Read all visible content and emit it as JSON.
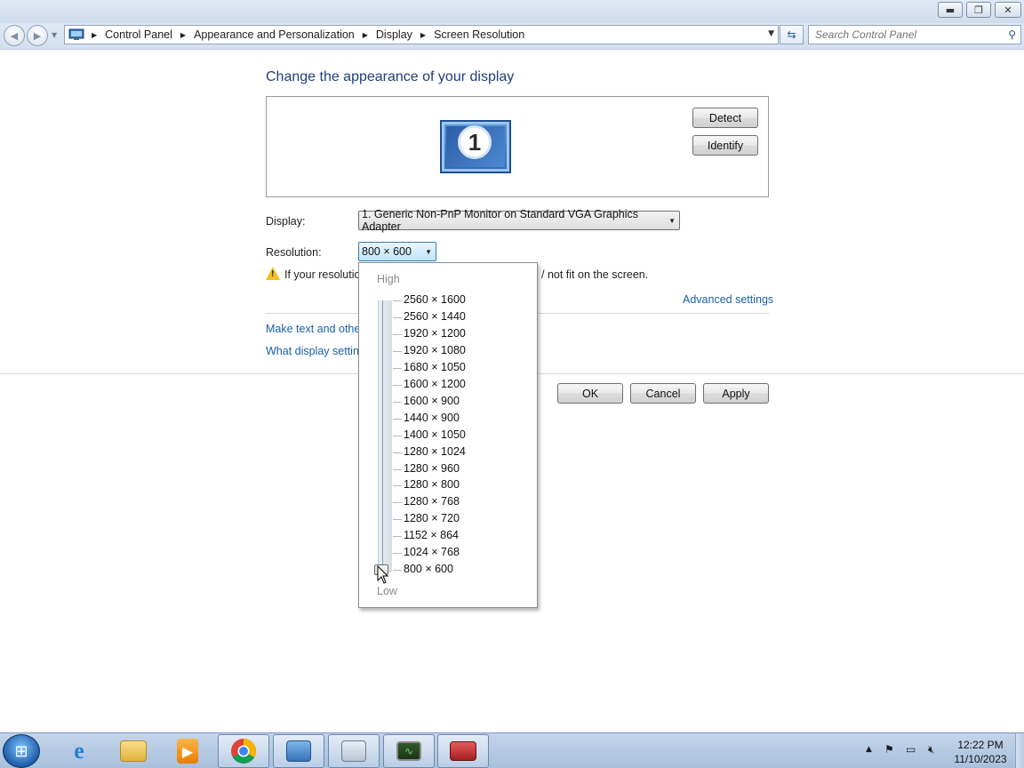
{
  "window": {
    "title_buttons": [
      "minimize",
      "restore",
      "close"
    ]
  },
  "navigation": {
    "breadcrumb": [
      "Control Panel",
      "Appearance and Personalization",
      "Display",
      "Screen Resolution"
    ],
    "search_placeholder": "Search Control Panel"
  },
  "content": {
    "heading": "Change the appearance of your display",
    "monitor_number": "1",
    "detect_label": "Detect",
    "identify_label": "Identify",
    "display_label": "Display:",
    "display_value": "1. Generic Non-PnP Monitor on Standard VGA Graphics Adapter",
    "resolution_label": "Resolution:",
    "resolution_value": "800 × 600",
    "warning_text_visible_start": "If your resolutio",
    "warning_text_visible_end": "/ not fit on the screen.",
    "advanced_settings_link": "Advanced settings",
    "link_make_text": "Make text and other",
    "link_display_settings": "What display setting",
    "ok_label": "OK",
    "cancel_label": "Cancel",
    "apply_label": "Apply"
  },
  "resolution_dropdown": {
    "high_label": "High",
    "low_label": "Low",
    "options": [
      "2560 × 1600",
      "2560 × 1440",
      "1920 × 1200",
      "1920 × 1080",
      "1680 × 1050",
      "1600 × 1200",
      "1600 × 900",
      "1440 × 900",
      "1400 × 1050",
      "1280 × 1024",
      "1280 × 960",
      "1280 × 800",
      "1280 × 768",
      "1280 × 720",
      "1152 × 864",
      "1024 × 768",
      "800 × 600"
    ],
    "selected": "800 × 600"
  },
  "taskbar": {
    "items": [
      "start-button",
      "internet-explorer",
      "windows-explorer",
      "media-player",
      "chrome",
      "control-panel",
      "display-settings",
      "task-manager",
      "toolbox"
    ],
    "clock_time": "12:22 PM",
    "clock_date": "11/10/2023"
  }
}
